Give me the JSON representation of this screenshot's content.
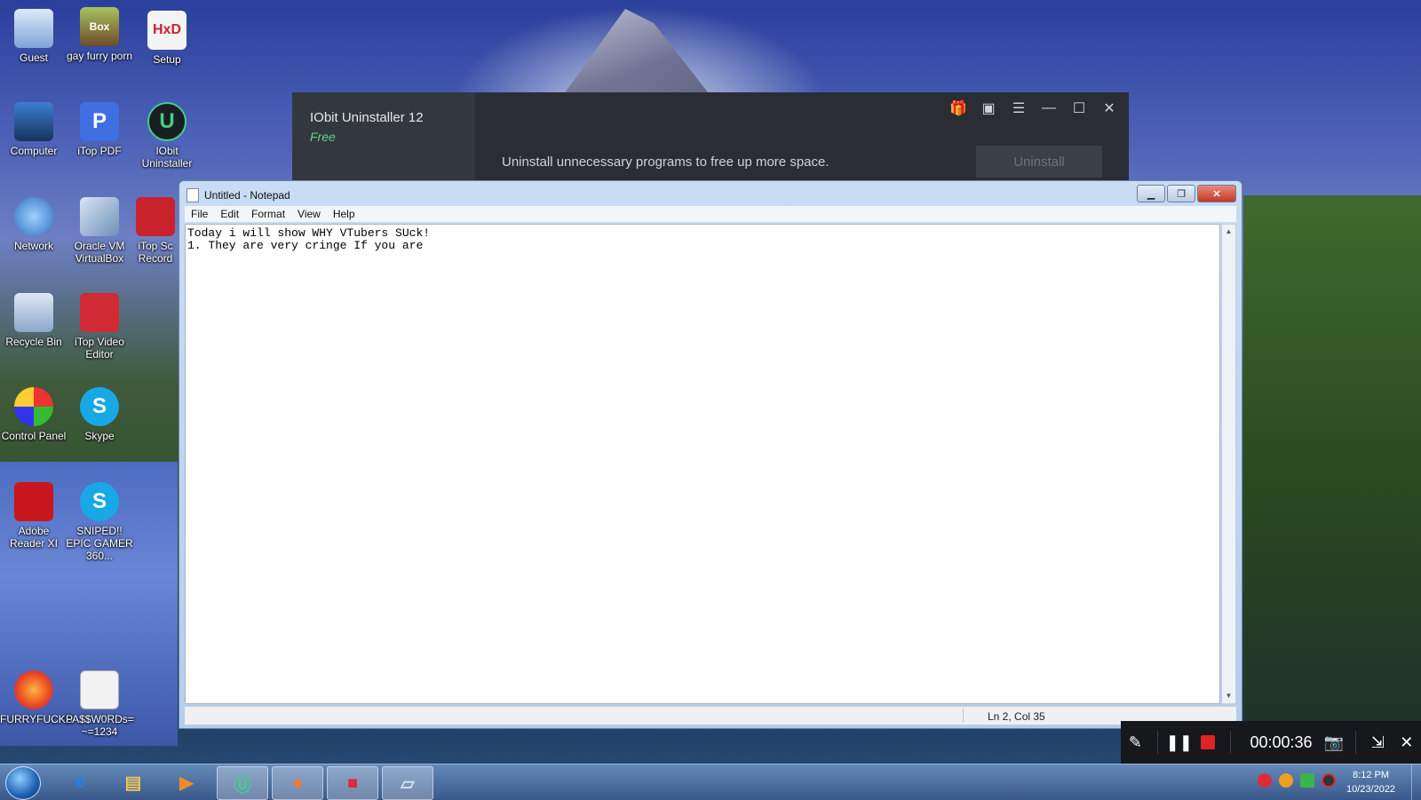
{
  "desktop_icons": [
    {
      "label": "Guest"
    },
    {
      "label": "gay furry porn",
      "badge": "Box"
    },
    {
      "label": "Setup",
      "glyph": "HxD"
    },
    {
      "label": "Computer"
    },
    {
      "label": "iTop PDF",
      "glyph": "P"
    },
    {
      "label": "IObit Uninstaller",
      "glyph": "U"
    },
    {
      "label": "Network"
    },
    {
      "label": "Oracle VM VirtualBox"
    },
    {
      "label": "iTop Sc Record"
    },
    {
      "label": "Recycle Bin"
    },
    {
      "label": "iTop Video Editor"
    },
    {
      "label": "Control Panel"
    },
    {
      "label": "Skype",
      "glyph": "S"
    },
    {
      "label": "Adobe Reader XI"
    },
    {
      "label": "SNIPED!! EPIC GAMER 360...",
      "glyph": "S"
    },
    {
      "label": "FURRYFUCKS"
    },
    {
      "label": "PA$$W0RDs= ~=1234"
    }
  ],
  "iobit": {
    "title": "IObit Uninstaller 12",
    "edition": "Free",
    "description": "Uninstall unnecessary programs to free up more space.",
    "uninstall_label": "Uninstall"
  },
  "notepad": {
    "title": "Untitled - Notepad",
    "menu": [
      "File",
      "Edit",
      "Format",
      "View",
      "Help"
    ],
    "text": "Today i will show WHY VTubers SUck!\n1. They are very cringe If you are",
    "status": "Ln 2, Col 35"
  },
  "recorder": {
    "time": "00:00:36"
  },
  "clock": {
    "time": "8:12 PM",
    "date": "10/23/2022"
  }
}
